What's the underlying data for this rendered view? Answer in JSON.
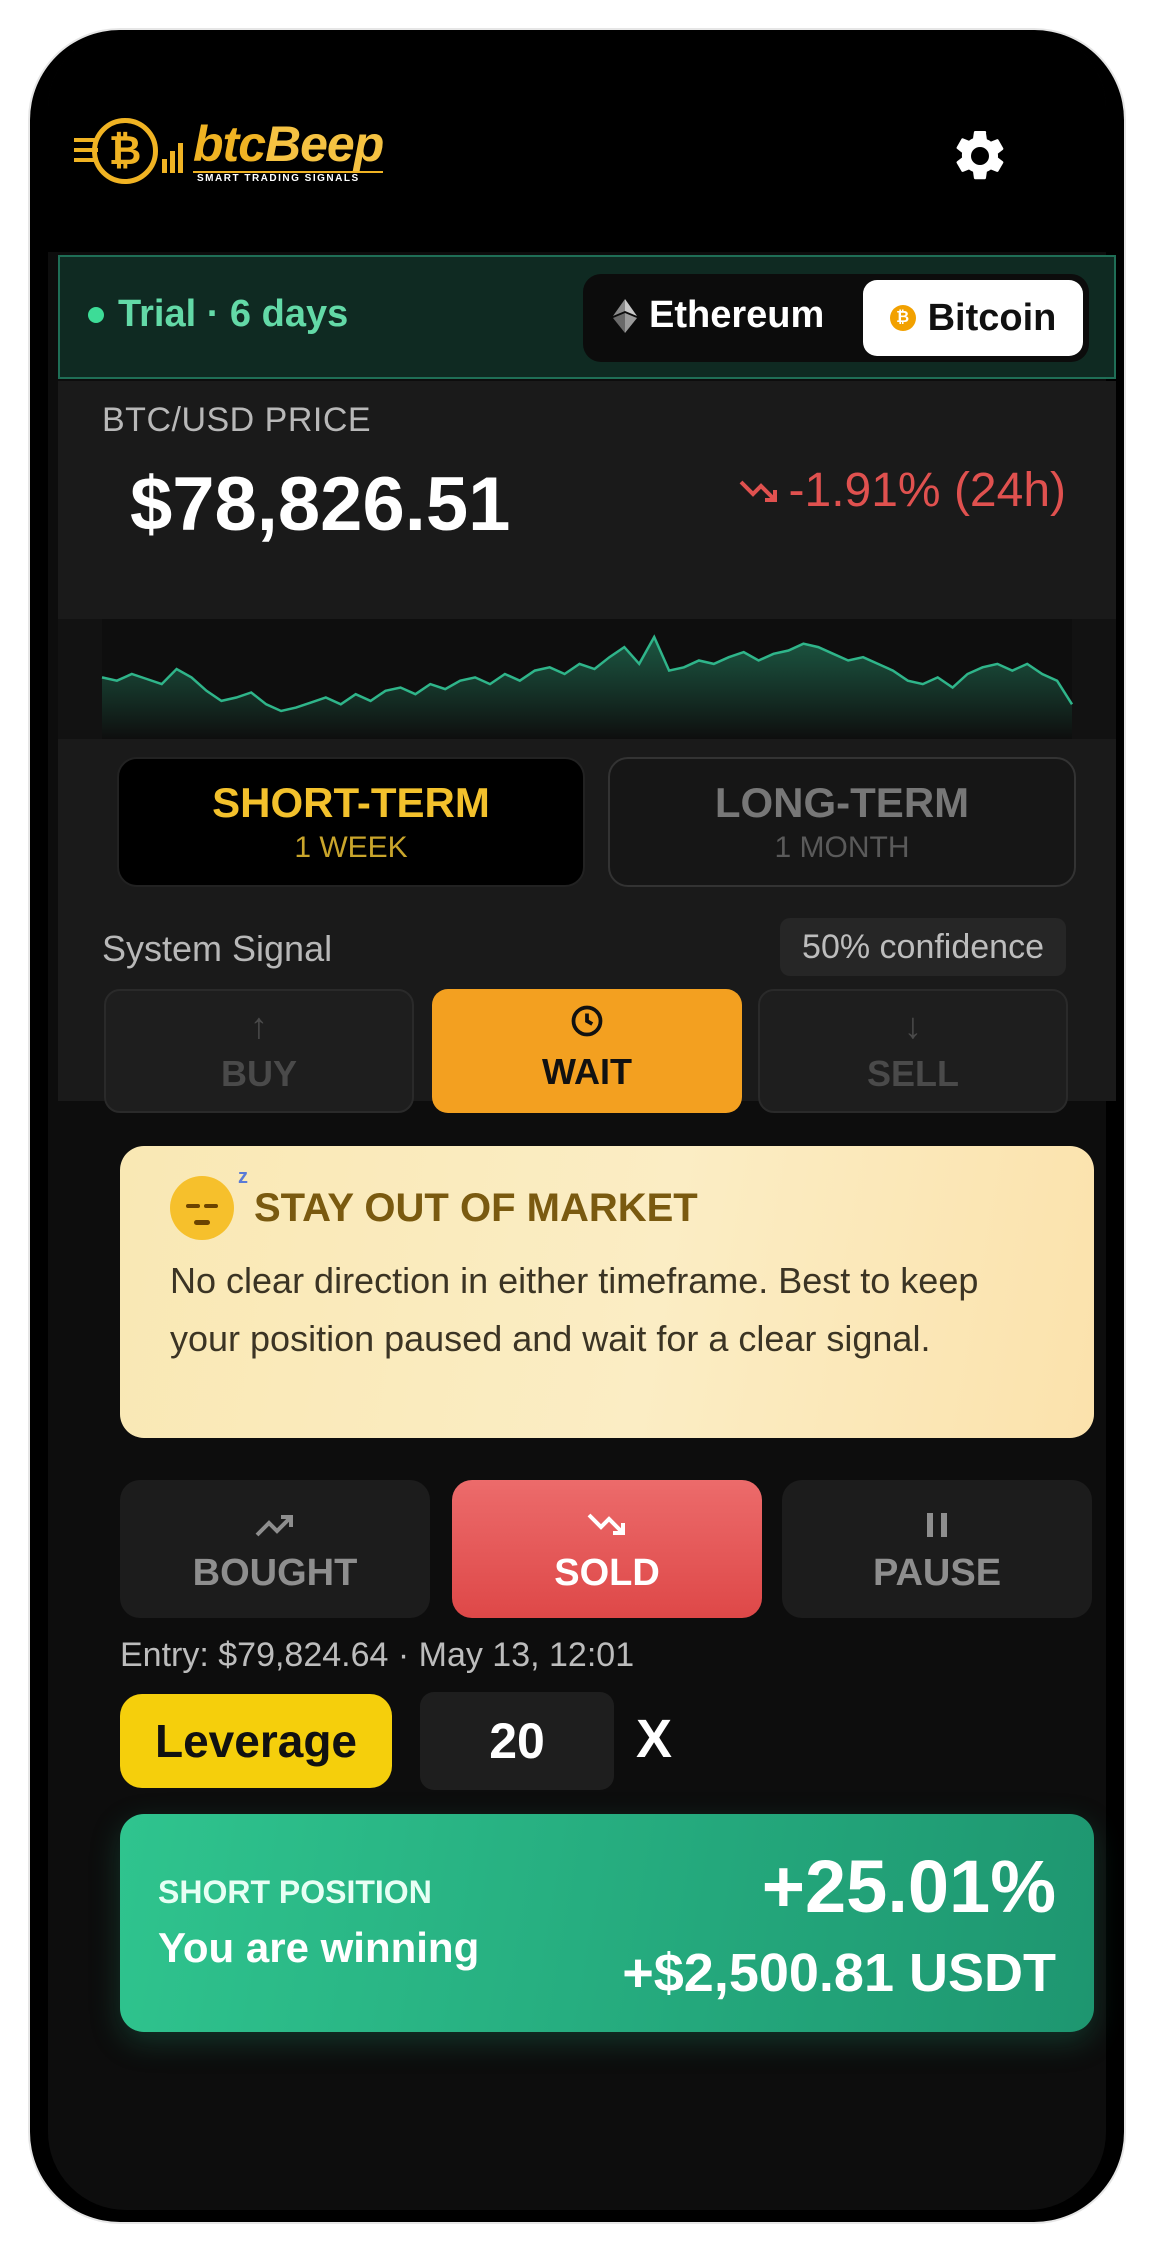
{
  "brand": {
    "name_part1": "btc",
    "name_part2": "Beep",
    "tagline": "SMART TRADING SIGNALS"
  },
  "header": {
    "settings_icon": "gear-icon"
  },
  "trial": {
    "label": "Trial · 6 days"
  },
  "coins": {
    "ethereum": "Ethereum",
    "bitcoin": "Bitcoin",
    "selected": "Bitcoin"
  },
  "price": {
    "label": "BTC/USD PRICE",
    "value": "$78,826.51",
    "change": "-1.91% (24h)",
    "change_color": "#e0514f"
  },
  "sparkline": {
    "values": [
      40,
      38,
      42,
      39,
      36,
      45,
      40,
      32,
      26,
      28,
      31,
      24,
      20,
      22,
      25,
      28,
      24,
      30,
      26,
      32,
      34,
      30,
      36,
      33,
      38,
      40,
      36,
      42,
      38,
      44,
      46,
      42,
      48,
      45,
      52,
      58,
      48,
      64,
      44,
      46,
      50,
      48,
      52,
      55,
      50,
      54,
      56,
      60,
      58,
      54,
      50,
      52,
      48,
      44,
      38,
      36,
      40,
      34,
      42,
      46,
      48,
      44,
      48,
      42,
      38,
      24
    ]
  },
  "terms": {
    "short": {
      "title": "SHORT-TERM",
      "subtitle": "1 WEEK"
    },
    "long": {
      "title": "LONG-TERM",
      "subtitle": "1 MONTH"
    }
  },
  "signal": {
    "label": "System Signal",
    "confidence": "50% confidence",
    "buy": "BUY",
    "wait": "WAIT",
    "sell": "SELL"
  },
  "advice": {
    "title": "STAY OUT OF MARKET",
    "text": "No clear direction in either timeframe. Best to keep your position paused and wait for a clear signal."
  },
  "position_buttons": {
    "bought": "BOUGHT",
    "sold": "SOLD",
    "pause": "PAUSE"
  },
  "entry": {
    "text": "Entry: $79,824.64  ·  May 13, 12:01"
  },
  "leverage": {
    "label": "Leverage",
    "value": "20",
    "suffix": "X"
  },
  "result": {
    "type": "SHORT POSITION",
    "status": "You are winning",
    "percent": "+25.01%",
    "usd": "+$2,500.81 USDT"
  },
  "colors": {
    "accent_gold": "#f0b323",
    "win_green": "#24a87c",
    "wait_orange": "#f3a020",
    "sold_red": "#e05050"
  }
}
